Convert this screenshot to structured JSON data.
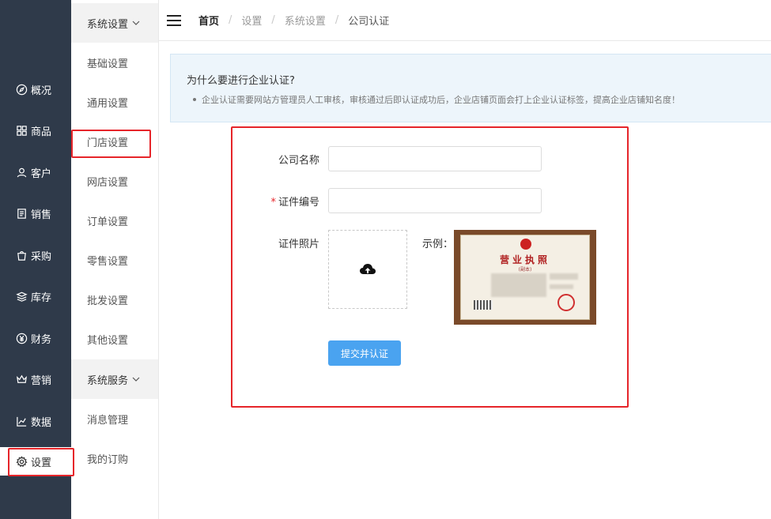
{
  "rail": {
    "items": [
      {
        "label": "概况",
        "icon": "compass-icon"
      },
      {
        "label": "商品",
        "icon": "grid-icon"
      },
      {
        "label": "客户",
        "icon": "user-icon"
      },
      {
        "label": "销售",
        "icon": "document-icon"
      },
      {
        "label": "采购",
        "icon": "bag-icon"
      },
      {
        "label": "库存",
        "icon": "layers-icon"
      },
      {
        "label": "财务",
        "icon": "yen-icon"
      },
      {
        "label": "营销",
        "icon": "crown-icon"
      },
      {
        "label": "数据",
        "icon": "chart-icon"
      },
      {
        "label": "设置",
        "icon": "gear-icon"
      }
    ]
  },
  "submenu": {
    "group1": "系统设置",
    "group1_items": [
      "基础设置",
      "通用设置",
      "门店设置",
      "网店设置",
      "订单设置",
      "零售设置",
      "批发设置",
      "其他设置"
    ],
    "group2": "系统服务",
    "group2_items": [
      "消息管理",
      "我的订购"
    ]
  },
  "breadcrumb": {
    "home": "首页",
    "level1": "设置",
    "level2": "系统设置",
    "current": "公司认证",
    "separator": "/"
  },
  "notice": {
    "title": "为什么要进行企业认证?",
    "text": "企业认证需要网站方管理员人工审核，审核通过后即认证成功后，企业店铺页面会打上企业认证标签，提高企业店铺知名度！"
  },
  "form": {
    "company_name_label": "公司名称",
    "company_name_value": "",
    "cert_number_label": "证件编号",
    "cert_number_required_mark": "*",
    "cert_number_value": "",
    "cert_photo_label": "证件照片",
    "example_label": "示例：",
    "license_title": "营业执照",
    "license_subtitle": "(副本)",
    "submit_label": "提交并认证"
  },
  "colors": {
    "rail_bg": "#2f3a4a",
    "accent_blue": "#4aa3f0",
    "highlight_red": "#e6252a"
  }
}
